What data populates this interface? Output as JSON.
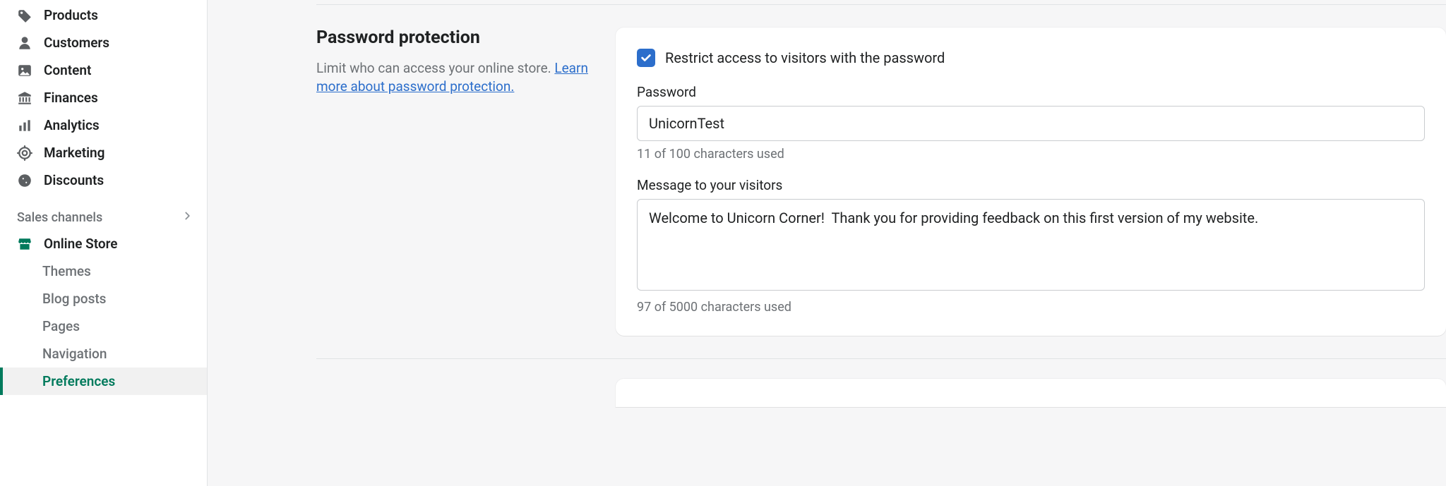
{
  "sidebar": {
    "items": [
      {
        "label": "Products"
      },
      {
        "label": "Customers"
      },
      {
        "label": "Content"
      },
      {
        "label": "Finances"
      },
      {
        "label": "Analytics"
      },
      {
        "label": "Marketing"
      },
      {
        "label": "Discounts"
      }
    ],
    "sales_channels_label": "Sales channels",
    "online_store_label": "Online Store",
    "subitems": [
      {
        "label": "Themes"
      },
      {
        "label": "Blog posts"
      },
      {
        "label": "Pages"
      },
      {
        "label": "Navigation"
      },
      {
        "label": "Preferences"
      }
    ]
  },
  "section": {
    "title": "Password protection",
    "desc_prefix": "Limit who can access your online store. ",
    "learn_more": "Learn more about password protection."
  },
  "form": {
    "restrict_label": "Restrict access to visitors with the password",
    "restrict_checked": true,
    "password_label": "Password",
    "password_value": "UnicornTest",
    "password_helper": "11 of 100 characters used",
    "message_label": "Message to your visitors",
    "message_value": "Welcome to Unicorn Corner!  Thank you for providing feedback on this first version of my website.",
    "message_helper": "97 of 5000 characters used"
  }
}
